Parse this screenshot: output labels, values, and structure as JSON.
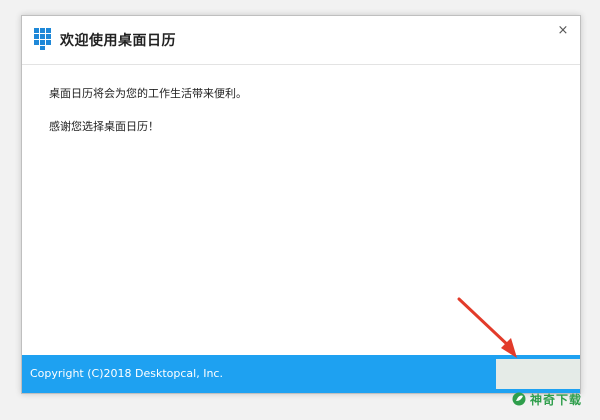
{
  "window": {
    "title": "欢迎使用桌面日历",
    "close_symbol": "×"
  },
  "content": {
    "paragraph1": "桌面日历将会为您的工作生活带来便利。",
    "paragraph2": "感谢您选择桌面日历！"
  },
  "footer": {
    "copyright": "Copyright (C)2018 Desktopcal, Inc."
  },
  "watermark": {
    "text": "神奇下载"
  },
  "icons": {
    "app_logo": "calendar-grid-icon",
    "close": "close-icon",
    "annotation": "red-arrow-icon",
    "watermark": "leaf-logo-icon"
  },
  "colors": {
    "footer_blue": "#1ea1f1",
    "logo_blue": "#1e88d8",
    "arrow_red": "#e23b2a",
    "watermark_green": "#2f9e4c"
  }
}
